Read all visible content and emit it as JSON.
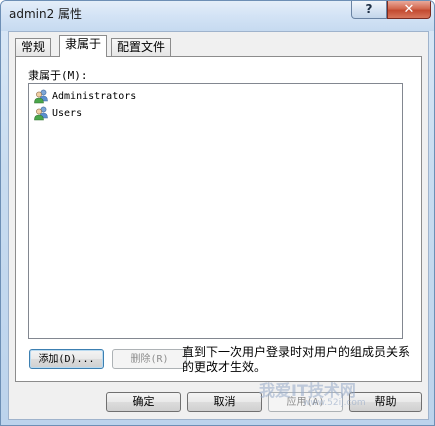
{
  "window": {
    "title": "admin2 属性",
    "help_label": "?",
    "close_label": "✕"
  },
  "tabs": [
    {
      "label": "常规",
      "active": false
    },
    {
      "label": "隶属于",
      "active": true
    },
    {
      "label": "配置文件",
      "active": false
    }
  ],
  "memberof": {
    "label": "隶属于(M):",
    "items": [
      {
        "label": "Administrators",
        "icon": "group-icon"
      },
      {
        "label": "Users",
        "icon": "group-icon"
      }
    ]
  },
  "actions": {
    "add_label": "添加(D)...",
    "remove_label": "删除(R)"
  },
  "note": "直到下一次用户登录时对用户的组成员关系的更改才生效。",
  "buttons": {
    "ok_label": "确定",
    "cancel_label": "取消",
    "apply_label": "应用(A)",
    "help_label": "帮助"
  },
  "watermark": {
    "logo": "我爱IT技术网",
    "url": "www.52ij.com"
  },
  "colors": {
    "frame": "#c8dcf0",
    "client": "#f0f0f0",
    "close_button": "#c34a30"
  }
}
